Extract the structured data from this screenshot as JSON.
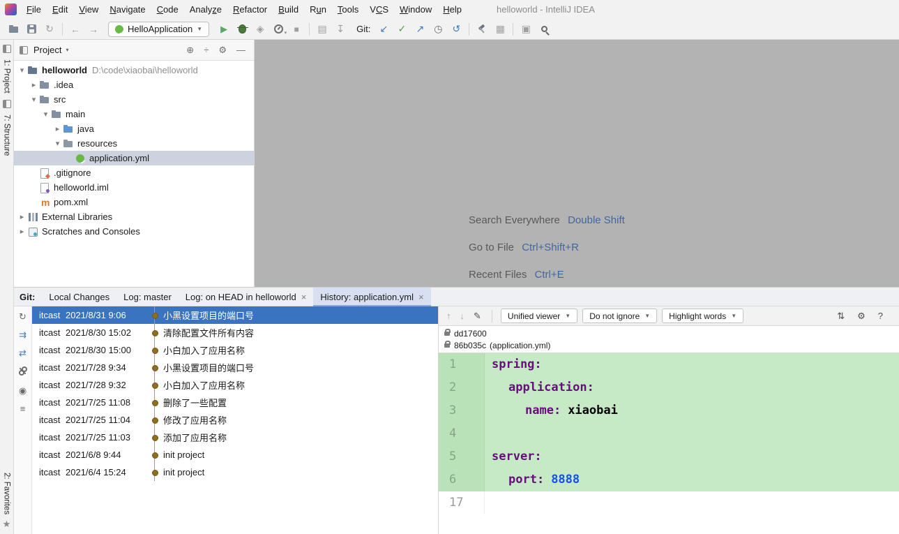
{
  "window": {
    "title": "helloworld - IntelliJ IDEA"
  },
  "menu": {
    "items": [
      {
        "pre": "",
        "key": "F",
        "rest": "ile",
        "label": "File"
      },
      {
        "pre": "",
        "key": "E",
        "rest": "dit",
        "label": "Edit"
      },
      {
        "pre": "",
        "key": "V",
        "rest": "iew",
        "label": "View"
      },
      {
        "pre": "",
        "key": "N",
        "rest": "avigate",
        "label": "Navigate"
      },
      {
        "pre": "",
        "key": "C",
        "rest": "ode",
        "label": "Code"
      },
      {
        "pre": "Analy",
        "key": "z",
        "rest": "e",
        "label": "Analyze"
      },
      {
        "pre": "",
        "key": "R",
        "rest": "efactor",
        "label": "Refactor"
      },
      {
        "pre": "",
        "key": "B",
        "rest": "uild",
        "label": "Build"
      },
      {
        "pre": "R",
        "key": "u",
        "rest": "n",
        "label": "Run"
      },
      {
        "pre": "",
        "key": "T",
        "rest": "ools",
        "label": "Tools"
      },
      {
        "pre": "V",
        "key": "C",
        "rest": "S",
        "label": "VCS"
      },
      {
        "pre": "",
        "key": "W",
        "rest": "indow",
        "label": "Window"
      },
      {
        "pre": "",
        "key": "H",
        "rest": "elp",
        "label": "Help"
      }
    ]
  },
  "toolbar": {
    "run_config": "HelloApplication",
    "git_label": "Git:"
  },
  "stripe": {
    "project": "1: Project",
    "structure": "7: Structure",
    "favorites": "2: Favorites"
  },
  "project": {
    "header": "Project",
    "tree": [
      {
        "label": "helloworld",
        "hint": "D:\\code\\xiaobai\\helloworld",
        "state": "open",
        "icon": "project",
        "level": 0,
        "bold": true
      },
      {
        "label": ".idea",
        "state": "closed",
        "icon": "folder",
        "level": 1
      },
      {
        "label": "src",
        "state": "open",
        "icon": "folder",
        "level": 1
      },
      {
        "label": "main",
        "state": "open",
        "icon": "folder",
        "level": 2
      },
      {
        "label": "java",
        "state": "closed",
        "icon": "folder-java",
        "level": 3
      },
      {
        "label": "resources",
        "state": "open",
        "icon": "folder-res",
        "level": 3
      },
      {
        "label": "application.yml",
        "state": "leaf",
        "icon": "spring",
        "level": 4,
        "selected": true
      },
      {
        "label": ".gitignore",
        "state": "leaf",
        "icon": "file-git",
        "level": 1
      },
      {
        "label": "helloworld.iml",
        "state": "leaf",
        "icon": "file-iml",
        "level": 1
      },
      {
        "label": "pom.xml",
        "state": "leaf",
        "icon": "maven",
        "level": 1
      },
      {
        "label": "External Libraries",
        "state": "closed",
        "icon": "libs",
        "level": 0
      },
      {
        "label": "Scratches and Consoles",
        "state": "closed",
        "icon": "scratch",
        "level": 0
      }
    ]
  },
  "editor": {
    "hints": [
      {
        "label": "Search Everywhere",
        "shortcut": "Double Shift"
      },
      {
        "label": "Go to File",
        "shortcut": "Ctrl+Shift+R"
      },
      {
        "label": "Recent Files",
        "shortcut": "Ctrl+E"
      }
    ]
  },
  "git": {
    "label": "Git:",
    "tabs": [
      {
        "label": "Local Changes"
      },
      {
        "label": "Log: master"
      },
      {
        "label": "Log: on HEAD in helloworld",
        "closable": true
      },
      {
        "label": "History: application.yml",
        "closable": true,
        "active": true
      }
    ],
    "commits": [
      {
        "author": "itcast",
        "date": "2021/8/31 9:06",
        "message": "小黑设置项目的端口号",
        "selected": true
      },
      {
        "author": "itcast",
        "date": "2021/8/30 15:02",
        "message": "清除配置文件所有内容"
      },
      {
        "author": "itcast",
        "date": "2021/8/30 15:00",
        "message": "小白加入了应用名称"
      },
      {
        "author": "itcast",
        "date": "2021/7/28 9:34",
        "message": "小黑设置项目的端口号"
      },
      {
        "author": "itcast",
        "date": "2021/7/28 9:32",
        "message": "小白加入了应用名称"
      },
      {
        "author": "itcast",
        "date": "2021/7/25 11:08",
        "message": "删除了一些配置"
      },
      {
        "author": "itcast",
        "date": "2021/7/25 11:04",
        "message": "修改了应用名称"
      },
      {
        "author": "itcast",
        "date": "2021/7/25 11:03",
        "message": "添加了应用名称"
      },
      {
        "author": "itcast",
        "date": "2021/6/8 9:44",
        "message": "init project"
      },
      {
        "author": "itcast",
        "date": "2021/6/4 15:24",
        "message": "init project"
      }
    ]
  },
  "diff": {
    "viewer": "Unified viewer",
    "ignore": "Do not ignore",
    "highlight": "Highlight words",
    "refs": [
      {
        "hash": "dd17600",
        "note": ""
      },
      {
        "hash": "86b035c",
        "note": "(application.yml)"
      }
    ],
    "lines": [
      {
        "num": "1",
        "key": "spring:",
        "value": "",
        "ind": 0,
        "added": true
      },
      {
        "num": "2",
        "key": "application:",
        "value": "",
        "ind": 1,
        "added": true
      },
      {
        "num": "3",
        "key": "name:",
        "value": "xiaobai",
        "ind": 2,
        "added": true
      },
      {
        "num": "4",
        "key": "",
        "value": "",
        "ind": 0,
        "added": true
      },
      {
        "num": "5",
        "key": "server:",
        "value": "",
        "ind": 0,
        "added": true
      },
      {
        "num": "6",
        "key": "port:",
        "value": "8888",
        "num_value": true,
        "ind": 1,
        "added": true
      },
      {
        "num": "17",
        "key": "",
        "value": "",
        "ind": 0,
        "added": false
      }
    ]
  },
  "icons": {
    "caret": "▼",
    "sync": "↻",
    "back": "←",
    "forward": "→",
    "run": "▶",
    "coverage": "◈",
    "stop": "■",
    "update": "↙",
    "commit": "✓",
    "push": "↗",
    "history": "◷",
    "rollback": "↺",
    "structure": "▦",
    "window": "▣",
    "find": "▤",
    "get": "↧",
    "up": "↑",
    "down": "↓",
    "edit": "✎",
    "collapse": "⇅",
    "gear": "⚙",
    "help": "?",
    "close": "×",
    "star": "★",
    "locate": "⊕",
    "collapseAll": "÷",
    "hide": "—",
    "expand": "▾",
    "refresh": "↻",
    "eye": "◉",
    "list": "≡",
    "compare": "⇄",
    "cherry": "⇉"
  }
}
